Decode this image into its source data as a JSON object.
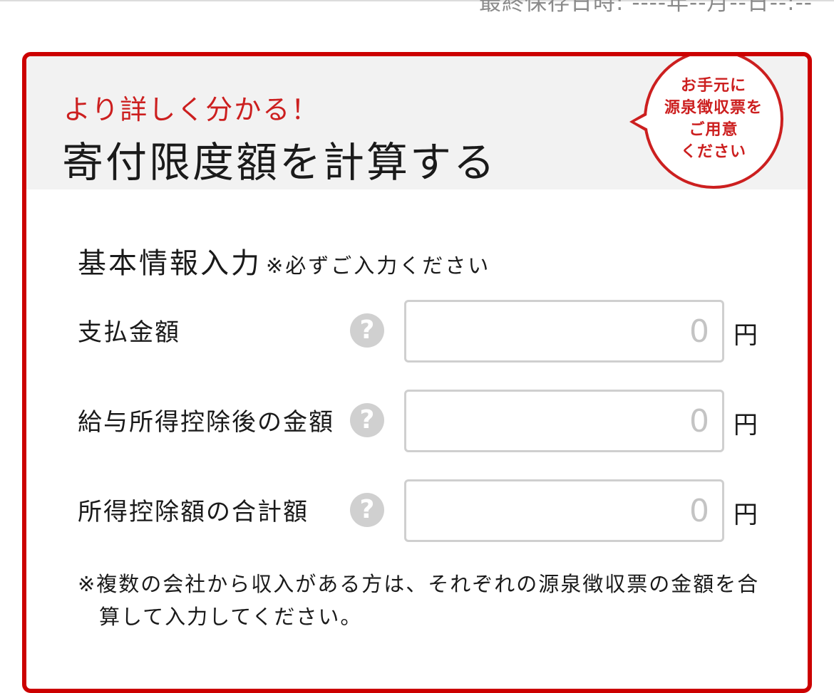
{
  "header": {
    "saved_time": "最終保存日時: ----年--月--日--:--"
  },
  "calculator": {
    "subtitle": "より詳しく分かる！",
    "title": "寄付限度額を計算する",
    "bubble_lines": [
      "お手元に",
      "源泉徴収票を",
      "ご用意",
      "ください"
    ],
    "section_title": "基本情報入力",
    "section_note": "※必ずご入力ください",
    "fields": [
      {
        "label": "支払金額",
        "value": "",
        "placeholder": "0",
        "unit": "円",
        "help_glyph": "?"
      },
      {
        "label": "給与所得控除後の金額",
        "value": "",
        "placeholder": "0",
        "unit": "円",
        "help_glyph": "?"
      },
      {
        "label": "所得控除額の合計額",
        "value": "",
        "placeholder": "0",
        "unit": "円",
        "help_glyph": "?"
      }
    ],
    "footnote": "※複数の会社から収入がある方は、それぞれの源泉徴収票の金額を合算して入力してください。"
  },
  "colors": {
    "accent_red": "#cc0000",
    "header_bg": "#f2f2f2",
    "help_icon_gray": "#d0d0d0"
  },
  "icons": {
    "help": "question-circle-icon"
  }
}
